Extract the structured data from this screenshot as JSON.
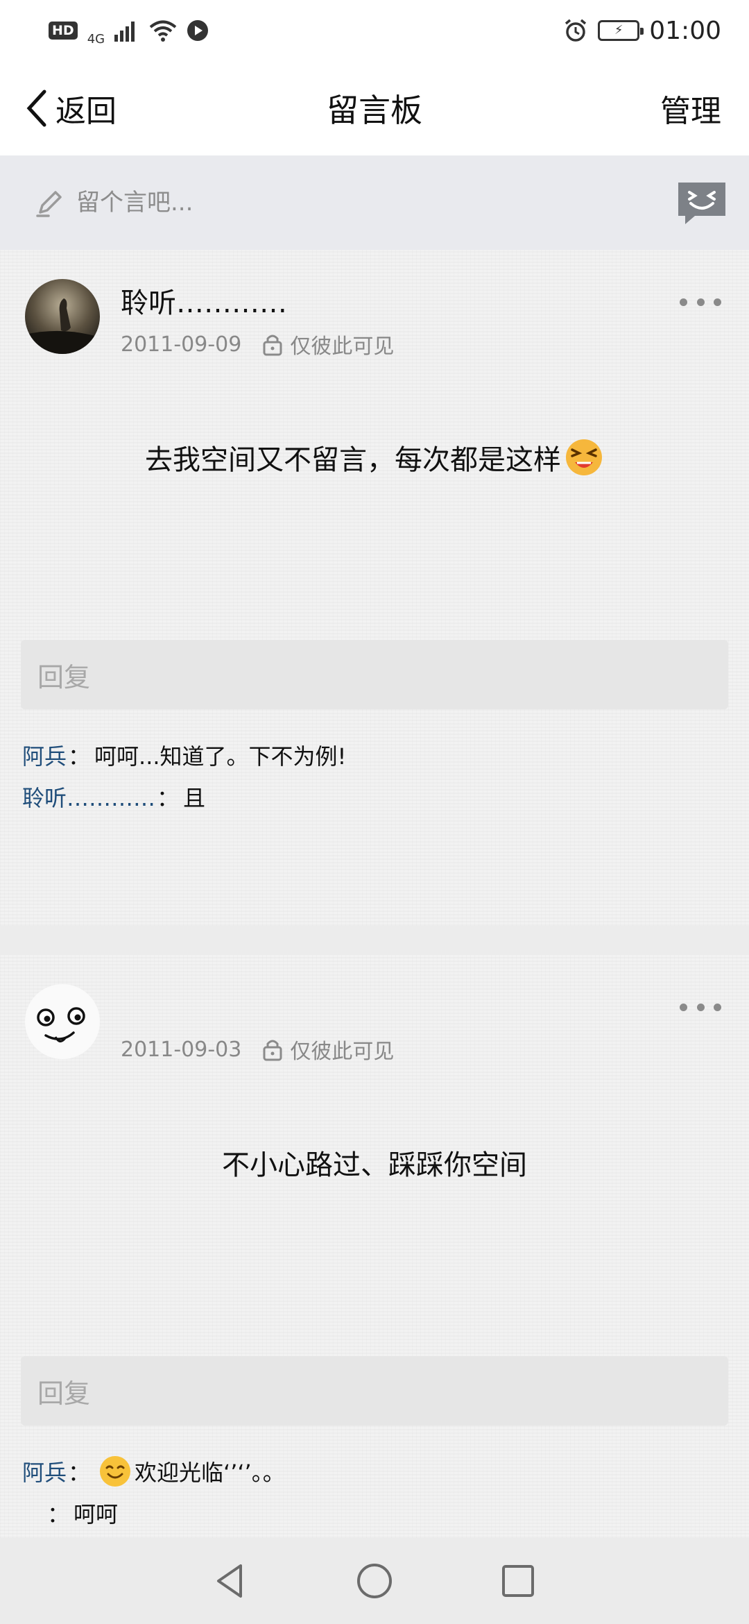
{
  "status_bar": {
    "hd_label": "HD",
    "network_label": "4G",
    "time": "01:00"
  },
  "nav": {
    "back_label": "返回",
    "title": "留言板",
    "manage_label": "管理"
  },
  "compose": {
    "placeholder": "留个言吧...",
    "icons": [
      "pen-icon",
      "emoji-icon"
    ]
  },
  "posts": [
    {
      "author": "聆听…………",
      "date": "2011-09-09",
      "visibility": "仅彼此可见",
      "message": "去我空间又不留言，每次都是这样",
      "reply_placeholder": "回复",
      "comments": [
        {
          "name": "阿兵",
          "sep": "：",
          "text": "呵呵...知道了。下不为例!"
        },
        {
          "name": "聆听…………",
          "sep": "：",
          "text": "且"
        }
      ]
    },
    {
      "author": "",
      "date": "2011-09-03",
      "visibility": "仅彼此可见",
      "message": "不小心路过、踩踩你空间",
      "reply_placeholder": "回复",
      "comments": [
        {
          "name": "阿兵",
          "sep": "：",
          "text": "欢迎光临‘’‘’。。"
        },
        {
          "name": "",
          "sep": "：",
          "text": "呵呵"
        }
      ]
    }
  ],
  "system_nav": {
    "icons": [
      "back-triangle-icon",
      "home-circle-icon",
      "recents-square-icon"
    ]
  },
  "colors": {
    "comment_name": "#1f4d7a",
    "meta_gray": "#888888",
    "compose_bg": "#e9eaee"
  }
}
